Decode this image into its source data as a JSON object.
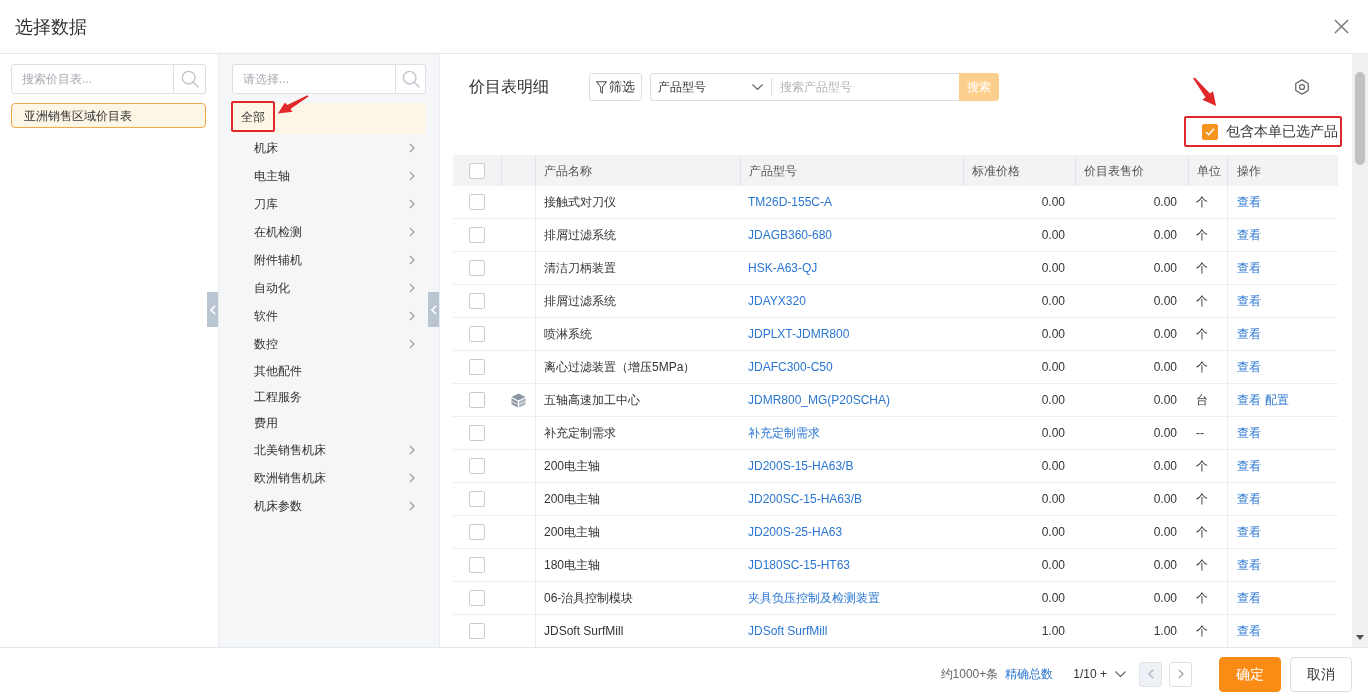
{
  "dialog": {
    "title": "选择数据"
  },
  "price_lists": {
    "search_placeholder": "搜索价目表...",
    "items": [
      {
        "label": "亚洲销售区域价目表",
        "selected": true
      }
    ]
  },
  "categories": {
    "search_placeholder": "请选择...",
    "items": [
      {
        "label": "全部",
        "selected": true,
        "highlighted": true,
        "children": [
          {
            "label": "机床",
            "selected": false,
            "highlighted": false,
            "has_children": true
          },
          {
            "label": "电主轴",
            "selected": false,
            "highlighted": false,
            "has_children": true
          },
          {
            "label": "刀库",
            "selected": false,
            "highlighted": false,
            "has_children": true
          },
          {
            "label": "在机检测",
            "selected": false,
            "highlighted": false,
            "has_children": true
          },
          {
            "label": "附件辅机",
            "selected": false,
            "highlighted": false,
            "has_children": true
          },
          {
            "label": "自动化",
            "selected": false,
            "highlighted": false,
            "has_children": true
          },
          {
            "label": "软件",
            "selected": false,
            "highlighted": false,
            "has_children": true
          },
          {
            "label": "数控",
            "selected": false,
            "highlighted": false,
            "has_children": true
          },
          {
            "label": "其他配件",
            "selected": false,
            "highlighted": false,
            "has_children": false
          },
          {
            "label": "工程服务",
            "selected": false,
            "highlighted": false,
            "has_children": false
          },
          {
            "label": "费用",
            "selected": false,
            "highlighted": false,
            "has_children": false
          },
          {
            "label": "北美销售机床",
            "selected": false,
            "highlighted": false,
            "has_children": true
          },
          {
            "label": "欧洲销售机床",
            "selected": false,
            "highlighted": false,
            "has_children": true
          },
          {
            "label": "机床参数",
            "selected": false,
            "highlighted": false,
            "has_children": true
          }
        ]
      }
    ]
  },
  "detail": {
    "title": "价目表明细",
    "filter_button": "筛选",
    "field_select": "产品型号",
    "search_placeholder": "搜索产品型号",
    "search_button": "搜索",
    "include_selected": {
      "label": "包含本单已选产品",
      "checked": true,
      "highlighted": true
    }
  },
  "table": {
    "header_checked": false,
    "columns": [
      "产品名称",
      "产品型号",
      "标准价格",
      "价目表售价",
      "单位",
      "操作"
    ],
    "rows": [
      {
        "checked": false,
        "kind": "item",
        "name": "接触式对刀仪",
        "model": "TM26D-155C-A",
        "standard_price": "0.00",
        "list_price": "0.00",
        "unit": "个",
        "actions": [
          "查看"
        ]
      },
      {
        "checked": false,
        "kind": "item",
        "name": "排屑过滤系统",
        "model": "JDAGB360-680",
        "standard_price": "0.00",
        "list_price": "0.00",
        "unit": "个",
        "actions": [
          "查看"
        ]
      },
      {
        "checked": false,
        "kind": "item",
        "name": "清洁刀柄装置",
        "model": "HSK-A63-QJ",
        "standard_price": "0.00",
        "list_price": "0.00",
        "unit": "个",
        "actions": [
          "查看"
        ]
      },
      {
        "checked": false,
        "kind": "item",
        "name": "排屑过滤系统",
        "model": "JDAYX320",
        "standard_price": "0.00",
        "list_price": "0.00",
        "unit": "个",
        "actions": [
          "查看"
        ]
      },
      {
        "checked": false,
        "kind": "item",
        "name": "喷淋系统",
        "model": "JDPLXT-JDMR800",
        "standard_price": "0.00",
        "list_price": "0.00",
        "unit": "个",
        "actions": [
          "查看"
        ]
      },
      {
        "checked": false,
        "kind": "item",
        "name": "离心过滤装置（增压5MPa）",
        "model": "JDAFC300-C50",
        "standard_price": "0.00",
        "list_price": "0.00",
        "unit": "个",
        "actions": [
          "查看"
        ]
      },
      {
        "checked": false,
        "kind": "assembly",
        "name": "五轴高速加工中心",
        "model": "JDMR800_MG(P20SCHA)",
        "standard_price": "0.00",
        "list_price": "0.00",
        "unit": "台",
        "actions": [
          "查看",
          "配置"
        ]
      },
      {
        "checked": false,
        "kind": "item",
        "name": "补充定制需求",
        "model": "补充定制需求",
        "standard_price": "0.00",
        "list_price": "0.00",
        "unit": "--",
        "actions": [
          "查看"
        ]
      },
      {
        "checked": false,
        "kind": "item",
        "name": "200电主轴",
        "model": "JD200S-15-HA63/B",
        "standard_price": "0.00",
        "list_price": "0.00",
        "unit": "个",
        "actions": [
          "查看"
        ]
      },
      {
        "checked": false,
        "kind": "item",
        "name": "200电主轴",
        "model": "JD200SC-15-HA63/B",
        "standard_price": "0.00",
        "list_price": "0.00",
        "unit": "个",
        "actions": [
          "查看"
        ]
      },
      {
        "checked": false,
        "kind": "item",
        "name": "200电主轴",
        "model": "JD200S-25-HA63",
        "standard_price": "0.00",
        "list_price": "0.00",
        "unit": "个",
        "actions": [
          "查看"
        ]
      },
      {
        "checked": false,
        "kind": "item",
        "name": "180电主轴",
        "model": "JD180SC-15-HT63",
        "standard_price": "0.00",
        "list_price": "0.00",
        "unit": "个",
        "actions": [
          "查看"
        ]
      },
      {
        "checked": false,
        "kind": "item",
        "name": "06-治具控制模块",
        "model": "夹具负压控制及检测装置",
        "standard_price": "0.00",
        "list_price": "0.00",
        "unit": "个",
        "actions": [
          "查看"
        ]
      },
      {
        "checked": false,
        "kind": "item",
        "name": "JDSoft SurfMill",
        "model": "JDSoft SurfMill",
        "standard_price": "1.00",
        "list_price": "1.00",
        "unit": "个",
        "actions": [
          "查看"
        ]
      }
    ]
  },
  "footer": {
    "count": "约1000+条",
    "exact_total_link": "精确总数",
    "pagination": {
      "label": "1/10 +",
      "prev_disabled": true,
      "next_disabled": false
    },
    "buttons": [
      {
        "label": "确定",
        "kind": "primary"
      },
      {
        "label": "取消",
        "kind": "secondary"
      }
    ]
  }
}
